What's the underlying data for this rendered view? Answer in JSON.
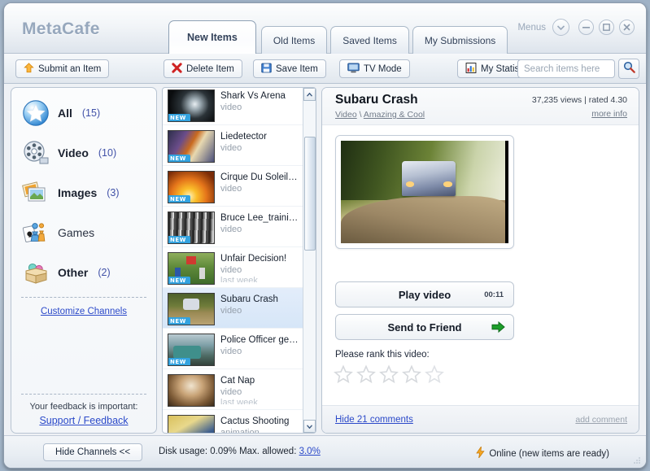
{
  "window": {
    "brand": "MetaCafe",
    "menus_label": "Menus",
    "controls": {
      "dropdown": "chevron-down-icon",
      "minimize": "minimize-icon",
      "maximize": "maximize-icon",
      "close": "close-icon"
    }
  },
  "tabs": [
    {
      "label": "New Items",
      "active": true
    },
    {
      "label": "Old Items",
      "active": false
    },
    {
      "label": "Saved Items",
      "active": false
    },
    {
      "label": "My Submissions",
      "active": false
    }
  ],
  "toolbar": {
    "submit_label": "Submit an Item",
    "delete_label": "Delete Item",
    "save_label": "Save Item",
    "tv_label": "TV Mode",
    "stats_label": "My Statistics",
    "search_placeholder": "Search items here",
    "search_value": ""
  },
  "sidebar": {
    "channels": [
      {
        "label": "All",
        "count": "(15)",
        "icon": "star-icon",
        "bold": true,
        "selected": true
      },
      {
        "label": "Video",
        "count": "(10)",
        "icon": "film-reel-icon",
        "bold": true,
        "selected": false
      },
      {
        "label": "Images",
        "count": "(3)",
        "icon": "photos-icon",
        "bold": true,
        "selected": false
      },
      {
        "label": "Games",
        "count": "",
        "icon": "games-icon",
        "bold": false,
        "selected": false
      },
      {
        "label": "Other",
        "count": "(2)",
        "icon": "box-icon",
        "bold": true,
        "selected": false
      }
    ],
    "customize_label": "Customize Channels",
    "feedback_title": "Your feedback is important:",
    "feedback_link": "Support / Feedback"
  },
  "items": [
    {
      "title": "Shark Vs Arena",
      "subtitle": "video",
      "date": "",
      "badge": "NEW",
      "selected": false,
      "thumb": "shark-thumb"
    },
    {
      "title": "Liedetector",
      "subtitle": "video",
      "date": "",
      "badge": "NEW",
      "selected": false,
      "thumb": "liedetector-thumb"
    },
    {
      "title": "Cirque Du Soleil (Osca...",
      "subtitle": "video",
      "date": "",
      "badge": "NEW",
      "selected": false,
      "thumb": "cirque-thumb"
    },
    {
      "title": "Bruce Lee_training",
      "subtitle": "video",
      "date": "",
      "badge": "NEW",
      "selected": false,
      "thumb": "brucelee-thumb"
    },
    {
      "title": "Unfair Decision!",
      "subtitle": "video",
      "date": "last week",
      "badge": "NEW",
      "selected": false,
      "thumb": "unfair-thumb"
    },
    {
      "title": "Subaru Crash",
      "subtitle": "video",
      "date": "",
      "badge": "NEW",
      "selected": true,
      "thumb": "subaru-thumb"
    },
    {
      "title": "Police Officer get Attack",
      "subtitle": "video",
      "date": "",
      "badge": "NEW",
      "selected": false,
      "thumb": "police-thumb"
    },
    {
      "title": "Cat Nap",
      "subtitle": "video",
      "date": "last week",
      "badge": "",
      "selected": false,
      "thumb": "catnap-thumb"
    },
    {
      "title": "Cactus Shooting",
      "subtitle": "animation",
      "date": "",
      "badge": "",
      "selected": false,
      "thumb": "cactus-thumb"
    }
  ],
  "detail": {
    "title": "Subaru Crash",
    "category_main": "Video",
    "category_sep": " \\ ",
    "category_sub": "Amazing & Cool",
    "stats": "37,235 views | rated 4.30",
    "more_info": "more info",
    "play_label": "Play video",
    "play_time": "00:11",
    "send_label": "Send to Friend",
    "rank_label": "Please rank this video:",
    "stars_filled": 0,
    "stars_total": 5,
    "hide_comments": "Hide 21 comments",
    "add_comment": "add comment"
  },
  "status": {
    "hide_channels": "Hide Channels <<",
    "disk_prefix": "Disk usage: 0.09%  Max. allowed: ",
    "disk_link": "3.0%",
    "online": "Online (new items are ready)"
  },
  "colors": {
    "accent_blue": "#2b49c9",
    "badge_blue": "#33a3e0",
    "selection": "#dbe8f8",
    "brand_gray": "#97a8bd"
  }
}
